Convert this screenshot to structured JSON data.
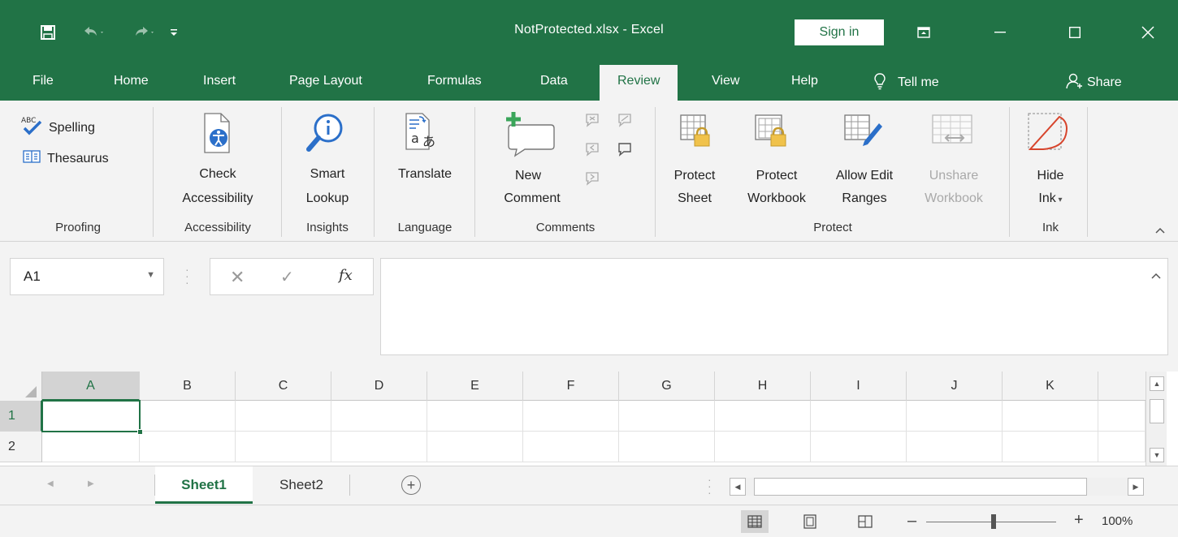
{
  "app": {
    "title": "NotProtected.xlsx  -  Excel",
    "sign_in": "Sign in"
  },
  "tabs": {
    "file": "File",
    "home": "Home",
    "insert": "Insert",
    "page_layout": "Page Layout",
    "formulas": "Formulas",
    "data": "Data",
    "review": "Review",
    "view": "View",
    "help": "Help",
    "tell_me": "Tell me",
    "share": "Share",
    "active": "Review"
  },
  "ribbon": {
    "proofing": {
      "label": "Proofing",
      "spelling": "Spelling",
      "thesaurus": "Thesaurus"
    },
    "accessibility": {
      "label": "Accessibility",
      "check_line1": "Check",
      "check_line2": "Accessibility"
    },
    "insights": {
      "label": "Insights",
      "line1": "Smart",
      "line2": "Lookup"
    },
    "language": {
      "label": "Language",
      "translate": "Translate"
    },
    "comments": {
      "label": "Comments",
      "new_line1": "New",
      "new_line2": "Comment"
    },
    "protect": {
      "label": "Protect",
      "sheet_line1": "Protect",
      "sheet_line2": "Sheet",
      "workbook_line1": "Protect",
      "workbook_line2": "Workbook",
      "allow_line1": "Allow Edit",
      "allow_line2": "Ranges",
      "unshare_line1": "Unshare",
      "unshare_line2": "Workbook"
    },
    "ink": {
      "label": "Ink",
      "hide_line1": "Hide",
      "hide_line2": "Ink"
    }
  },
  "formula_bar": {
    "name_box": "A1",
    "fx": "fx",
    "value": ""
  },
  "grid": {
    "columns": [
      "A",
      "B",
      "C",
      "D",
      "E",
      "F",
      "G",
      "H",
      "I",
      "J",
      "K"
    ],
    "rows": [
      "1",
      "2"
    ],
    "selected_cell": "A1"
  },
  "sheets": {
    "tabs": [
      "Sheet1",
      "Sheet2"
    ],
    "active": "Sheet1"
  },
  "status": {
    "zoom": "100%"
  },
  "colors": {
    "accent": "#217346",
    "ribbon_bg": "#f3f3f3"
  }
}
